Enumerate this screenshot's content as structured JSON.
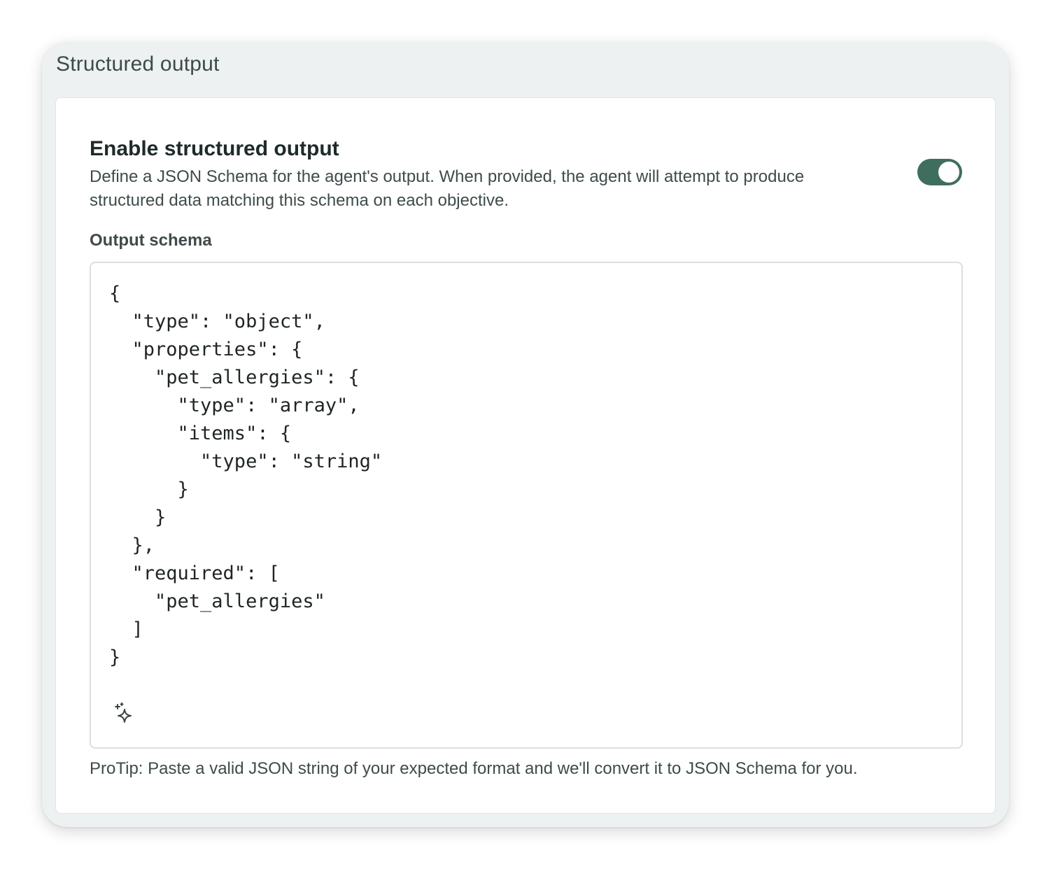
{
  "panel": {
    "title": "Structured output"
  },
  "setting": {
    "title": "Enable structured output",
    "description": "Define a JSON Schema for the agent's output. When provided, the agent will attempt to produce structured data matching this schema on each objective.",
    "enabled": true
  },
  "schema_field": {
    "label": "Output schema",
    "value": "{\n  \"type\": \"object\",\n  \"properties\": {\n    \"pet_allergies\": {\n      \"type\": \"array\",\n      \"items\": {\n        \"type\": \"string\"\n      }\n    }\n  },\n  \"required\": [\n    \"pet_allergies\"\n  ]\n}",
    "assist_icon": "sparkle-icon"
  },
  "protip": "ProTip: Paste a valid JSON string of your expected format and we'll convert it to JSON Schema for you.",
  "colors": {
    "toggle_on": "#3f6e5e",
    "panel_bg": "#eef1f1"
  }
}
